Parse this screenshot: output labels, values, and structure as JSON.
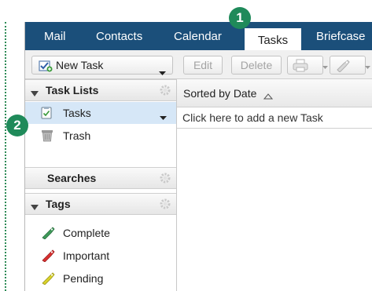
{
  "tabs": {
    "mail": "Mail",
    "contacts": "Contacts",
    "calendar": "Calendar",
    "tasks": "Tasks",
    "briefcase": "Briefcase"
  },
  "toolbar": {
    "new_task": "New Task",
    "edit": "Edit",
    "delete": "Delete"
  },
  "sidebar": {
    "task_lists_header": "Task Lists",
    "task_lists": [
      {
        "label": "Tasks",
        "icon": "checklist-icon",
        "selected": true
      },
      {
        "label": "Trash",
        "icon": "trash-icon",
        "selected": false
      }
    ],
    "searches_header": "Searches",
    "tags_header": "Tags",
    "tags": [
      {
        "label": "Complete",
        "color": "#3f9a5a"
      },
      {
        "label": "Important",
        "color": "#d93030"
      },
      {
        "label": "Pending",
        "color": "#d9d22a"
      }
    ]
  },
  "list": {
    "sort_label": "Sorted by Date",
    "add_placeholder": "Click here to add a new Task"
  },
  "callouts": [
    "1",
    "2"
  ],
  "colors": {
    "tabbar": "#1b4f7a",
    "selected_row": "#d6e7f7",
    "callout": "#1f8a5a"
  }
}
